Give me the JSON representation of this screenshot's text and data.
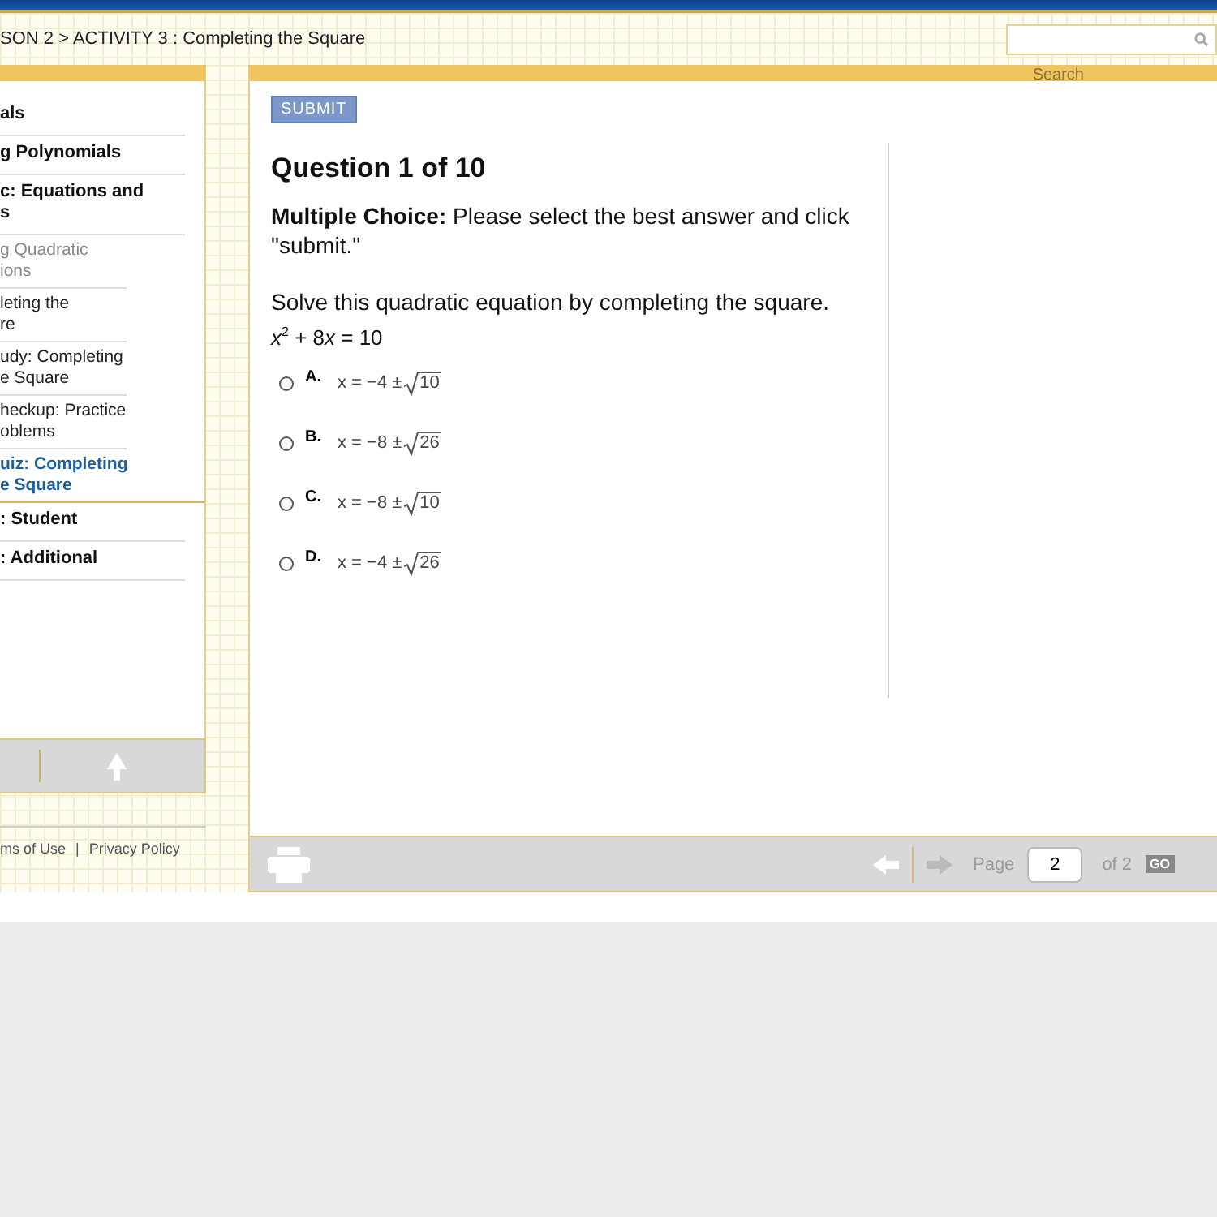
{
  "breadcrumb": "SON 2 > ACTIVITY 3 : Completing the Square",
  "search": {
    "label": "Search"
  },
  "sidebar": {
    "items": [
      {
        "label": "als",
        "selected": false
      },
      {
        "label": "g Polynomials",
        "selected": false
      },
      {
        "label": "c: Equations and\ns",
        "selected": false,
        "children": [
          {
            "label": "g Quadratic\nions",
            "selected": false,
            "visited": true
          },
          {
            "label": "leting the\nre",
            "selected": false,
            "visited": false
          },
          {
            "label": "udy: Completing\ne Square",
            "selected": false,
            "visited": false
          },
          {
            "label": "heckup: Practice\noblems",
            "selected": false,
            "visited": false
          },
          {
            "label": "uiz: Completing\ne Square",
            "selected": true,
            "visited": false
          }
        ]
      },
      {
        "label": ": Student",
        "selected": false
      },
      {
        "label": ": Additional",
        "selected": false
      }
    ]
  },
  "footer": {
    "links": [
      "ms of Use",
      "Privacy Policy"
    ],
    "separator": "|"
  },
  "question": {
    "submit": "SUBMIT",
    "title": "Question 1 of 10",
    "instructions": "**Multiple Choice:** Please select the best answer and click \"submit.\"",
    "prompt": "Solve this quadratic equation by completing the square.",
    "equation": [
      {
        "text": "x",
        "kind": "variable"
      },
      {
        "text": "2",
        "kind": "superscript"
      },
      {
        "text": " + 8",
        "kind": "plain"
      },
      {
        "text": "x",
        "kind": "variable"
      },
      {
        "text": " = 10",
        "kind": "plain"
      }
    ],
    "options": [
      {
        "letter": "A.",
        "expression": "x = −4 ±",
        "radicand": "10",
        "selected": false
      },
      {
        "letter": "B.",
        "expression": "x = −8 ±",
        "radicand": "26",
        "selected": false
      },
      {
        "letter": "C.",
        "expression": "x = −8 ±",
        "radicand": "10",
        "selected": false
      },
      {
        "letter": "D.",
        "expression": "x = −4 ±",
        "radicand": "26",
        "selected": false
      }
    ]
  },
  "pager": {
    "label": "Page",
    "value": "2",
    "total": "of 2",
    "go": "GO"
  }
}
